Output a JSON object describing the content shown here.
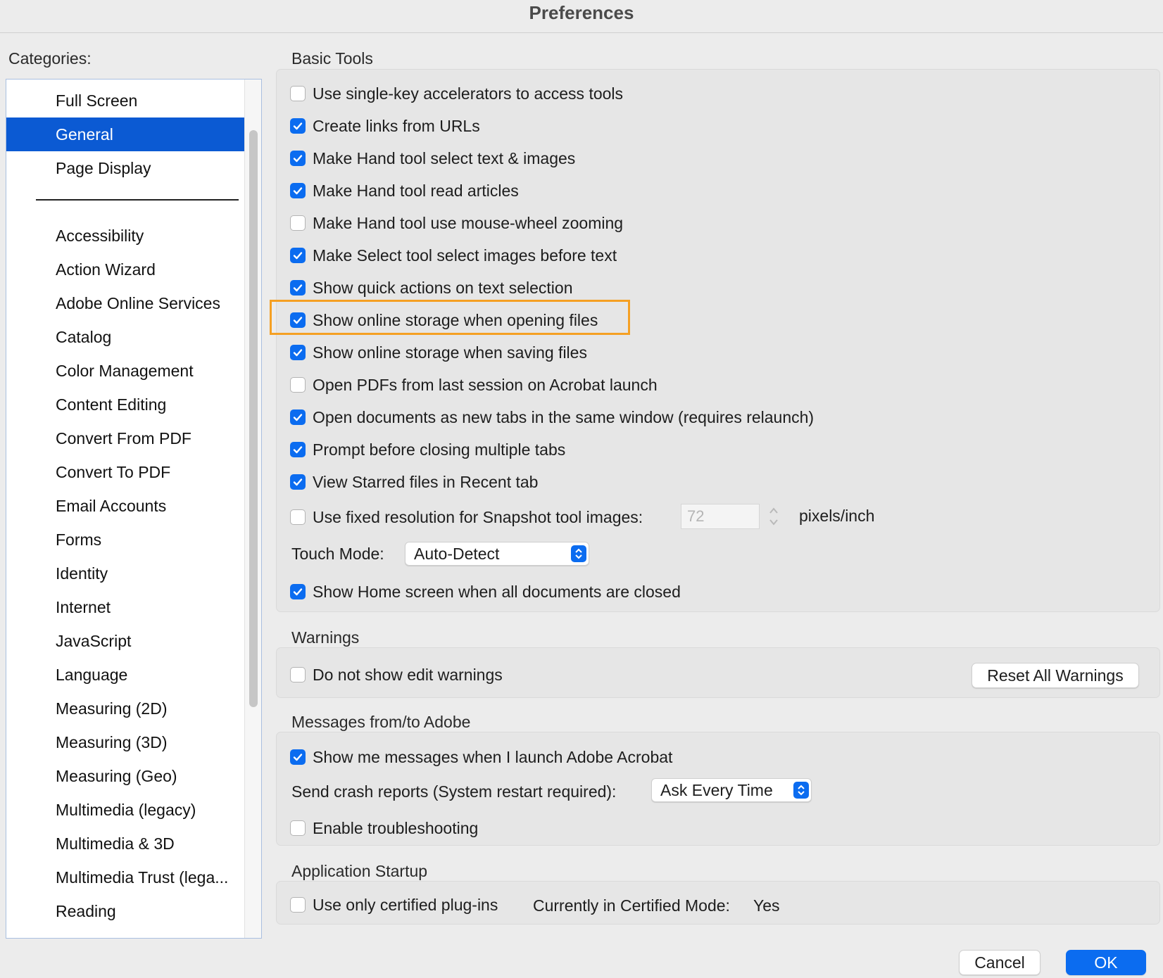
{
  "window": {
    "title": "Preferences"
  },
  "categories": {
    "label": "Categories:",
    "top_items": [
      "Full Screen",
      "General",
      "Page Display"
    ],
    "items": [
      "Accessibility",
      "Action Wizard",
      "Adobe Online Services",
      "Catalog",
      "Color Management",
      "Content Editing",
      "Convert From PDF",
      "Convert To PDF",
      "Email Accounts",
      "Forms",
      "Identity",
      "Internet",
      "JavaScript",
      "Language",
      "Measuring (2D)",
      "Measuring (3D)",
      "Measuring (Geo)",
      "Multimedia (legacy)",
      "Multimedia & 3D",
      "Multimedia Trust (lega...",
      "Reading"
    ],
    "selected": "General"
  },
  "basic_tools": {
    "title": "Basic Tools",
    "options": [
      {
        "label": "Use single-key accelerators to access tools",
        "checked": false
      },
      {
        "label": "Create links from URLs",
        "checked": true
      },
      {
        "label": "Make Hand tool select text & images",
        "checked": true
      },
      {
        "label": "Make Hand tool read articles",
        "checked": true
      },
      {
        "label": "Make Hand tool use mouse-wheel zooming",
        "checked": false
      },
      {
        "label": "Make Select tool select images before text",
        "checked": true
      },
      {
        "label": "Show quick actions on text selection",
        "checked": true
      },
      {
        "label": "Show online storage when opening files",
        "checked": true
      },
      {
        "label": "Show online storage when saving files",
        "checked": true
      },
      {
        "label": "Open PDFs from last session on Acrobat launch",
        "checked": false
      },
      {
        "label": "Open documents as new tabs in the same window (requires relaunch)",
        "checked": true
      },
      {
        "label": "Prompt before closing multiple tabs",
        "checked": true
      },
      {
        "label": "View Starred files in Recent tab",
        "checked": true
      }
    ],
    "snapshot": {
      "label": "Use fixed resolution for Snapshot tool images:",
      "checked": false,
      "value": "72",
      "unit": "pixels/inch"
    },
    "touch_mode": {
      "label": "Touch Mode:",
      "value": "Auto-Detect"
    },
    "home_screen": {
      "label": "Show Home screen when all documents are closed",
      "checked": true
    }
  },
  "warnings": {
    "title": "Warnings",
    "option": {
      "label": "Do not show edit warnings",
      "checked": false
    },
    "reset_button": "Reset All Warnings"
  },
  "messages": {
    "title": "Messages from/to Adobe",
    "show_messages": {
      "label": "Show me messages when I launch Adobe Acrobat",
      "checked": true
    },
    "crash_reports": {
      "label": "Send crash reports (System restart required):",
      "value": "Ask Every Time"
    },
    "troubleshooting": {
      "label": "Enable troubleshooting",
      "checked": false
    }
  },
  "startup": {
    "title": "Application Startup",
    "certified": {
      "label": "Use only certified plug-ins",
      "checked": false
    },
    "mode_label": "Currently in Certified Mode:",
    "mode_value": "Yes"
  },
  "footer": {
    "cancel": "Cancel",
    "ok": "OK"
  },
  "colors": {
    "accent": "#0b6cf0",
    "selection": "#0b5ad3",
    "highlight": "#f5a023"
  }
}
